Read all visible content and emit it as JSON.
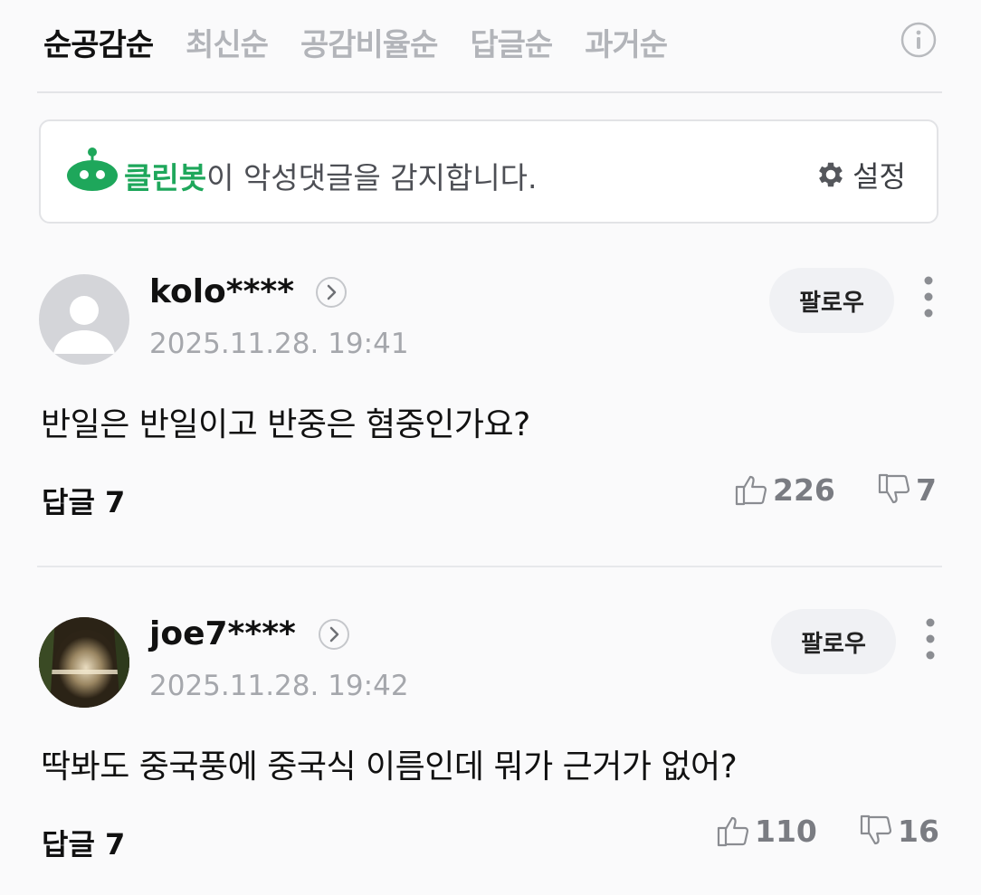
{
  "sort_tabs": [
    "순공감순",
    "최신순",
    "공감비율순",
    "답글순",
    "과거순"
  ],
  "cleanbot": {
    "name": "클린봇",
    "message": "이 악성댓글을 감지합니다.",
    "settings_label": "설정",
    "brand_color": "#1ea75b"
  },
  "comments": [
    {
      "username": "kolo****",
      "timestamp": "2025.11.28. 19:41",
      "follow_label": "팔로우",
      "text": "반일은 반일이고 반중은 혐중인가요?",
      "reply_label": "답글 7",
      "likes": "226",
      "dislikes": "7"
    },
    {
      "username": "joe7****",
      "timestamp": "2025.11.28. 19:42",
      "follow_label": "팔로우",
      "text": "딱봐도 중국풍에 중국식 이름인데 뭐가 근거가 없어?",
      "reply_label": "답글 7",
      "likes": "110",
      "dislikes": "16"
    }
  ]
}
